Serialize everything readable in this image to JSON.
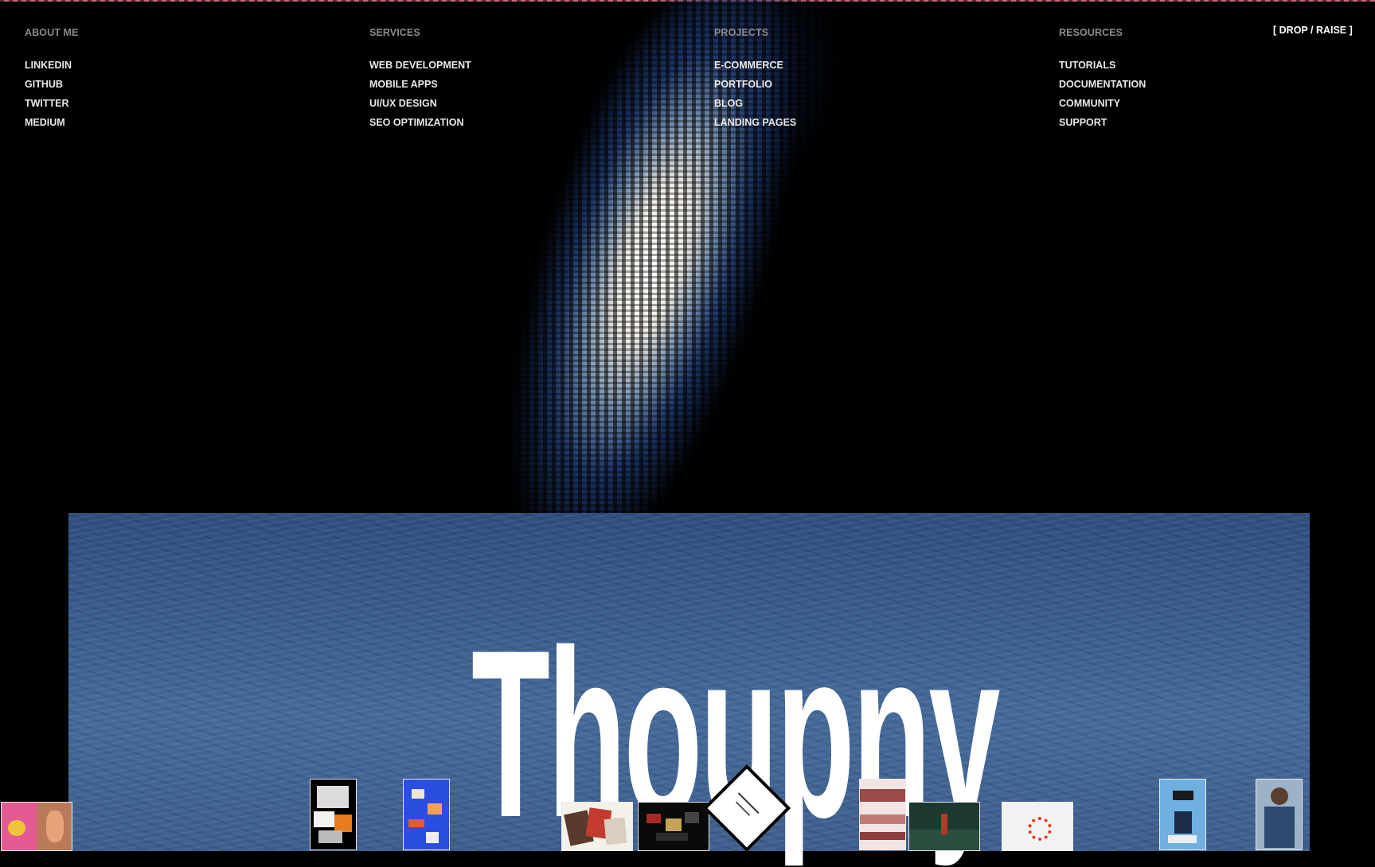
{
  "nav": {
    "about": {
      "heading": "ABOUT ME",
      "links": [
        "LINKEDIN",
        "GITHUB",
        "TWITTER",
        "MEDIUM"
      ]
    },
    "services": {
      "heading": "SERVICES",
      "links": [
        "WEB DEVELOPMENT",
        "MOBILE APPS",
        "UI/UX DESIGN",
        "SEO OPTIMIZATION"
      ]
    },
    "projects": {
      "heading": "PROJECTS",
      "links": [
        "E-COMMERCE",
        "PORTFOLIO",
        "BLOG",
        "LANDING PAGES"
      ]
    },
    "resources": {
      "heading": "RESOURCES",
      "links": [
        "TUTORIALS",
        "DOCUMENTATION",
        "COMMUNITY",
        "SUPPORT"
      ]
    },
    "toggle_label": "[ DROP / RAISE ]"
  },
  "brand": {
    "name": "Thoupny"
  },
  "colors": {
    "accent_line": "#c06a78",
    "ocean": "#3a5c8c",
    "text": "#e8e8e8",
    "muted": "#8a8a8a"
  },
  "thumbnails": [
    "collage-fruit-ear",
    "black-white-collage",
    "blue-scatter-collage",
    "paper-collage",
    "dark-grid",
    "diamond-card",
    "pink-ribbon",
    "dark-forest",
    "red-burst",
    "blue-pattern",
    "portrait"
  ]
}
